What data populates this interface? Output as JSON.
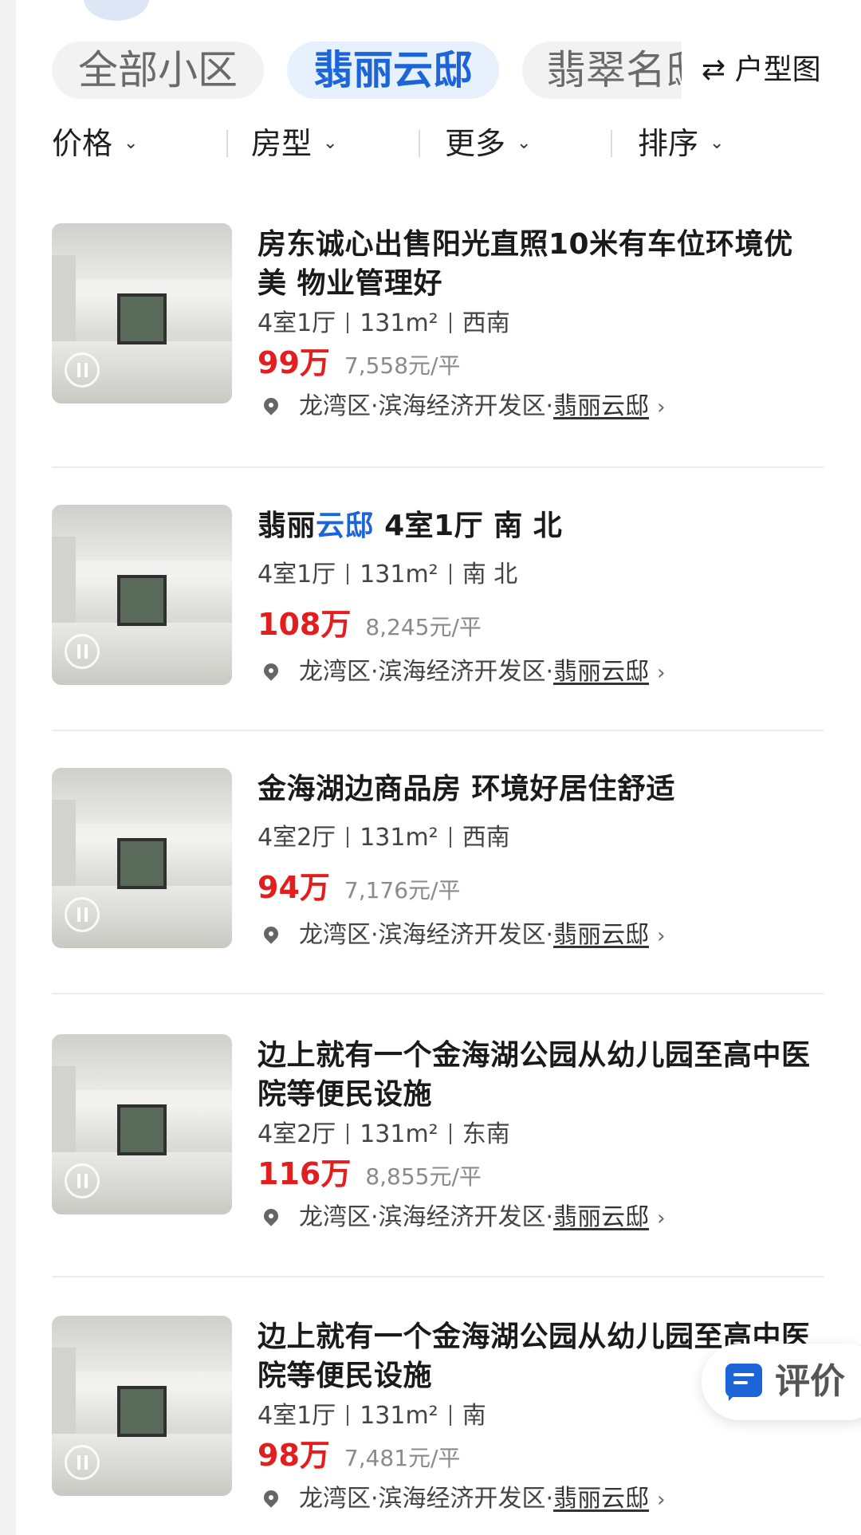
{
  "tabs": {
    "items": [
      {
        "label": "全部小区"
      },
      {
        "label": "翡丽云邸"
      },
      {
        "label": "翡翠名邸"
      }
    ],
    "layout_button": "⇄ 户型图"
  },
  "filters": [
    {
      "label": "价格"
    },
    {
      "label": "房型"
    },
    {
      "label": "更多"
    },
    {
      "label": "排序"
    }
  ],
  "listings": [
    {
      "title": "房东诚心出售阳光直照10米有车位环境优美 物业管理好",
      "rooms": "4室1厅",
      "area": "131m²",
      "orientation": "西南",
      "price": "99万",
      "unit_price": "7,558元/平",
      "district": "龙湾区·滨海经济开发区·",
      "community": "翡丽云邸"
    },
    {
      "title_prefix": "翡丽",
      "title_highlight": "云邸",
      "title_suffix": " 4室1厅 南 北",
      "rooms": "4室1厅",
      "area": "131m²",
      "orientation": "南 北",
      "price": "108万",
      "unit_price": "8,245元/平",
      "district": "龙湾区·滨海经济开发区·",
      "community": "翡丽云邸"
    },
    {
      "title": "金海湖边商品房 环境好居住舒适",
      "rooms": "4室2厅",
      "area": "131m²",
      "orientation": "西南",
      "price": "94万",
      "unit_price": "7,176元/平",
      "district": "龙湾区·滨海经济开发区·",
      "community": "翡丽云邸"
    },
    {
      "title": "边上就有一个金海湖公园从幼儿园至高中医院等便民设施",
      "rooms": "4室2厅",
      "area": "131m²",
      "orientation": "东南",
      "price": "116万",
      "unit_price": "8,855元/平",
      "district": "龙湾区·滨海经济开发区·",
      "community": "翡丽云邸"
    },
    {
      "title": "边上就有一个金海湖公园从幼儿园至高中医院等便民设施",
      "rooms": "4室1厅",
      "area": "131m²",
      "orientation": "南",
      "price": "98万",
      "unit_price": "7,481元/平",
      "district": "龙湾区·滨海经济开发区·",
      "community": "翡丽云邸"
    }
  ],
  "fab": {
    "label": "评价",
    "icon": "comment-icon"
  },
  "colors": {
    "accent": "#1d64d6",
    "price": "#e21e1e",
    "unit_price": "#8a8a8a"
  }
}
